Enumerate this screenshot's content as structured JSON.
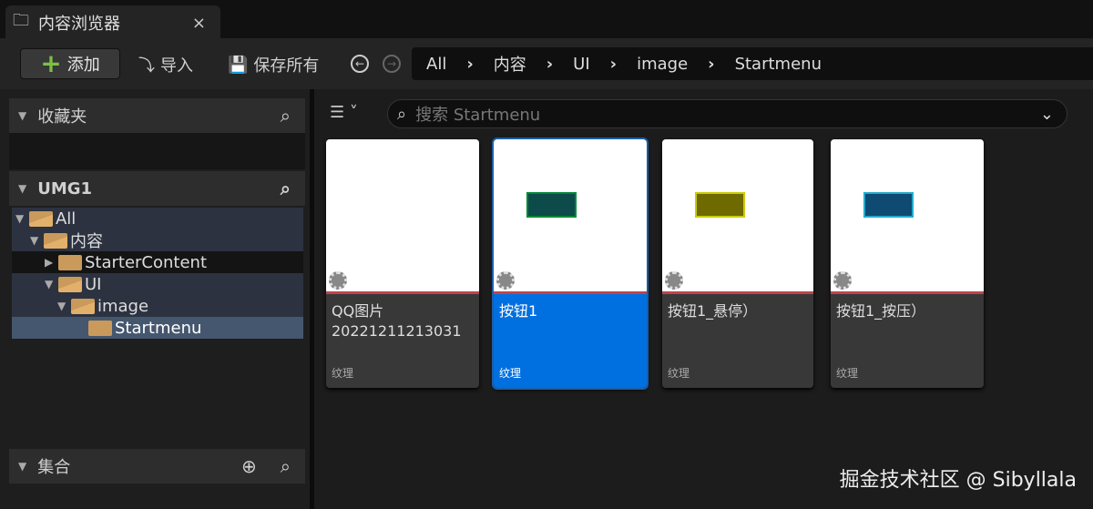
{
  "tab": {
    "title": "内容浏览器",
    "close": "×"
  },
  "toolbar": {
    "add": "添加",
    "import": "导入",
    "save_all": "保存所有"
  },
  "breadcrumb": [
    "All",
    "内容",
    "UI",
    "image",
    "Startmenu"
  ],
  "left": {
    "favorites": "收藏夹",
    "project": "UMG1",
    "collections": "集合",
    "tree": [
      {
        "label": "All",
        "open": true
      },
      {
        "label": "内容",
        "open": true
      },
      {
        "label": "StarterContent",
        "open": false
      },
      {
        "label": "UI",
        "open": true
      },
      {
        "label": "image",
        "open": true
      },
      {
        "label": "Startmenu",
        "open": false
      }
    ]
  },
  "search": {
    "placeholder": "搜索 Startmenu"
  },
  "assets": [
    {
      "name": "QQ图片\n20221211213031",
      "type": "纹理",
      "selected": false
    },
    {
      "name": "按钮1",
      "type": "纹理",
      "selected": true,
      "color": "#0d4a4a"
    },
    {
      "name": "按钮1_悬停）",
      "type": "纹理",
      "selected": false,
      "color": "#6e6a00"
    },
    {
      "name": "按钮1_按压）",
      "type": "纹理",
      "selected": false,
      "color": "#0e4a72"
    }
  ],
  "watermark": "掘金技术社区 @ Sibyllala"
}
